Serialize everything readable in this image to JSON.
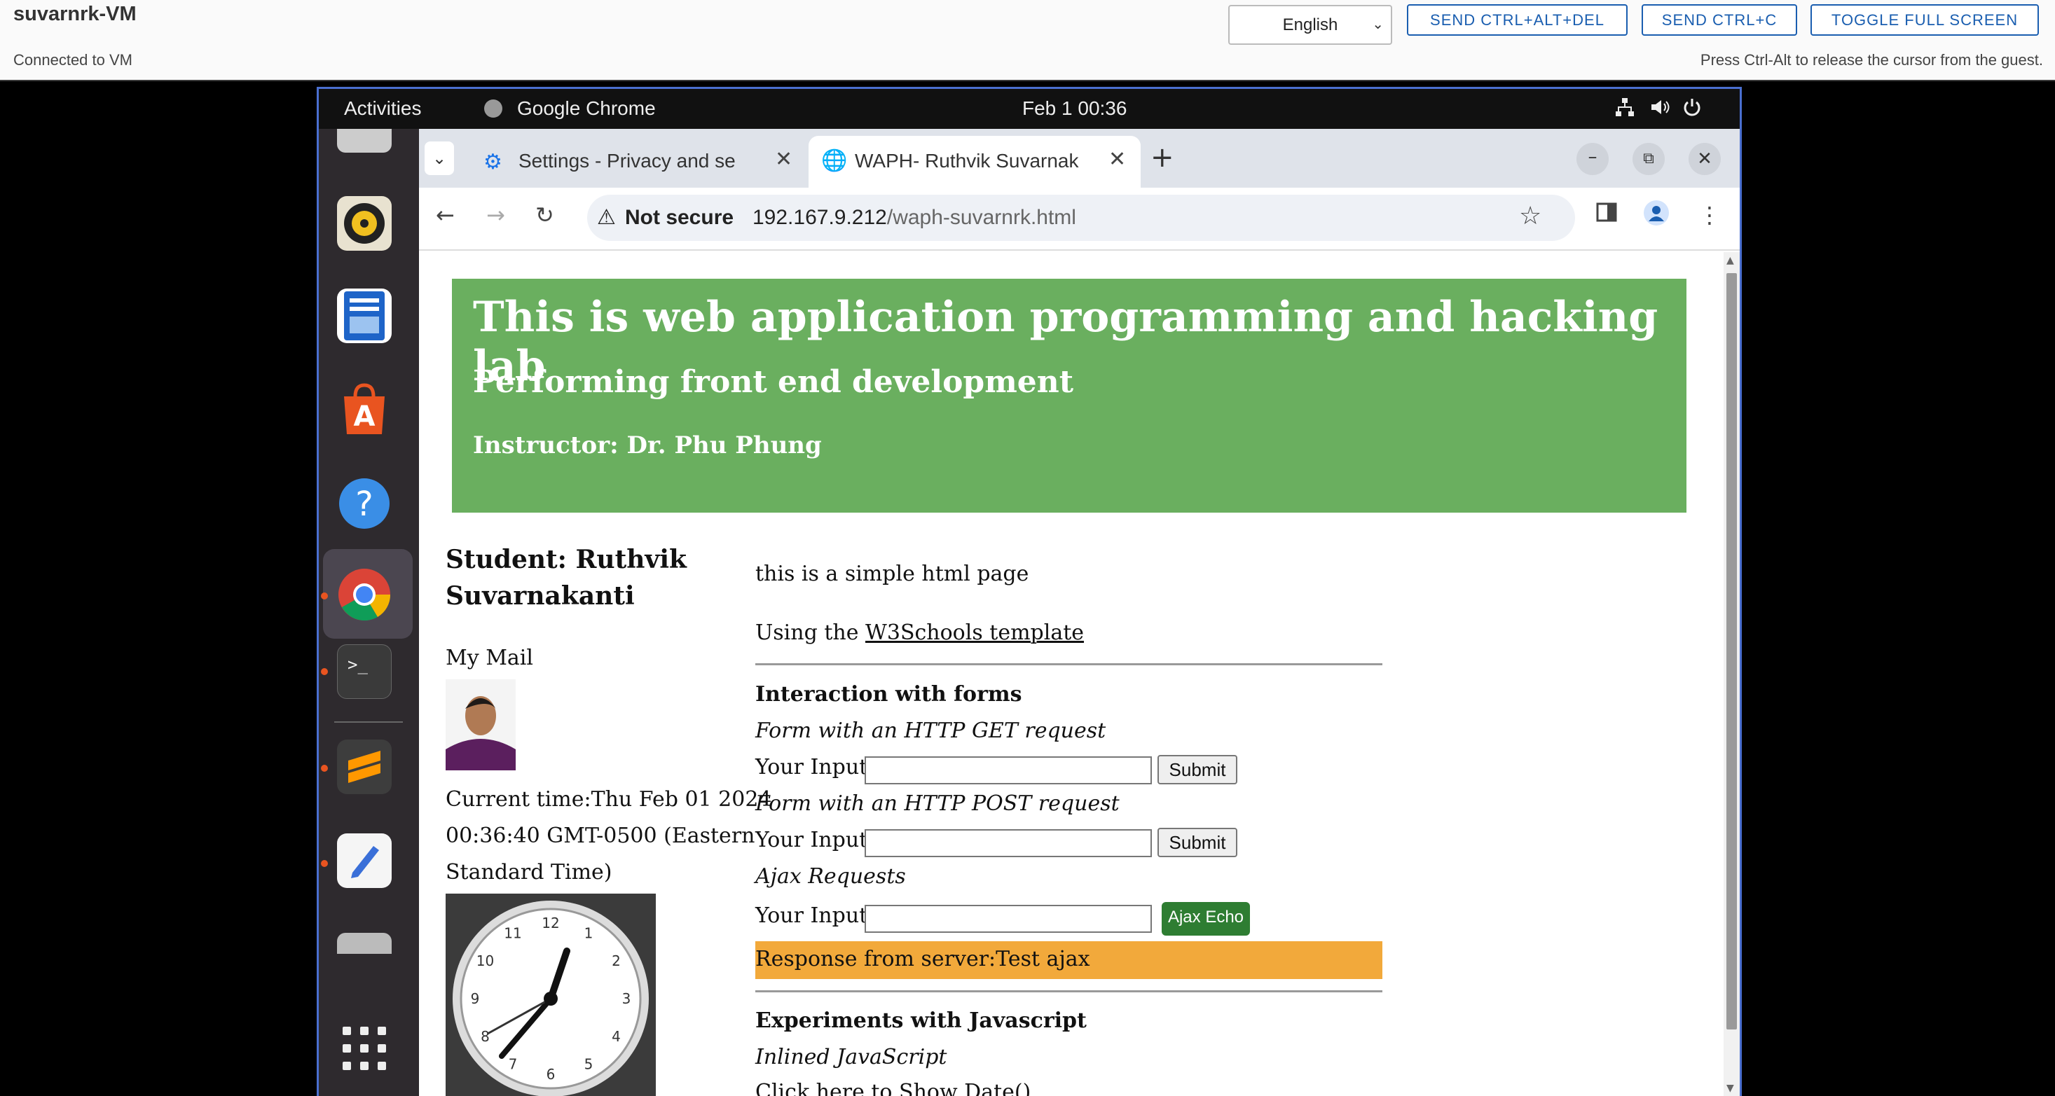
{
  "console": {
    "vm_name": "suvarnrk-VM",
    "status": "Connected to VM",
    "release_hint": "Press Ctrl-Alt to release the cursor from the guest.",
    "language": "English",
    "buttons": {
      "ctrl_alt_del": "SEND CTRL+ALT+DEL",
      "ctrl_c": "SEND CTRL+C",
      "fullscreen": "TOGGLE FULL SCREEN"
    }
  },
  "gnome": {
    "activities": "Activities",
    "app_name": "Google Chrome",
    "clock": "Feb 1  00:36"
  },
  "chrome": {
    "tabs": [
      {
        "title": "Settings - Privacy and se"
      },
      {
        "title": "WAPH- Ruthvik Suvarnak"
      }
    ],
    "not_secure": "Not secure",
    "url_host": "192.167.9.212",
    "url_path": "/waph-suvarnrk.html"
  },
  "page": {
    "banner_title": "This is web application programming and hacking lab",
    "banner_subtitle": "Performing front end development",
    "banner_instructor": "Instructor: Dr. Phu Phung",
    "student_line1": "Student: Ruthvik",
    "student_line2": "Suvarnakanti",
    "my_mail": "My Mail",
    "time_line1": "Current time:Thu Feb 01 2024",
    "time_line2": "00:36:40 GMT-0500 (Eastern",
    "time_line3": "Standard Time)",
    "intro": "this is a simple html page",
    "using_prefix": "Using the ",
    "using_link": "W3Schools template",
    "forms_heading": "Interaction with forms",
    "get_label": "Form with an HTTP GET request",
    "post_label": "Form with an HTTP POST request",
    "ajax_label": "Ajax Requests",
    "input_label": "Your Input:",
    "submit": "Submit",
    "ajax_echo": "Ajax Echo",
    "response": "Response from server:Test ajax",
    "js_heading": "Experiments with Javascript",
    "inlined_js": "Inlined JavaScript",
    "show_date": "Click here to Show Date()"
  },
  "clock_numbers": [
    "12",
    "1",
    "2",
    "3",
    "4",
    "5",
    "6",
    "7",
    "8",
    "9",
    "10",
    "11"
  ],
  "colors": {
    "banner": "#6aaf5f",
    "response_bg": "#f2a93b",
    "ajax_button": "#2e7d32",
    "header_button": "#1a5eb0"
  }
}
